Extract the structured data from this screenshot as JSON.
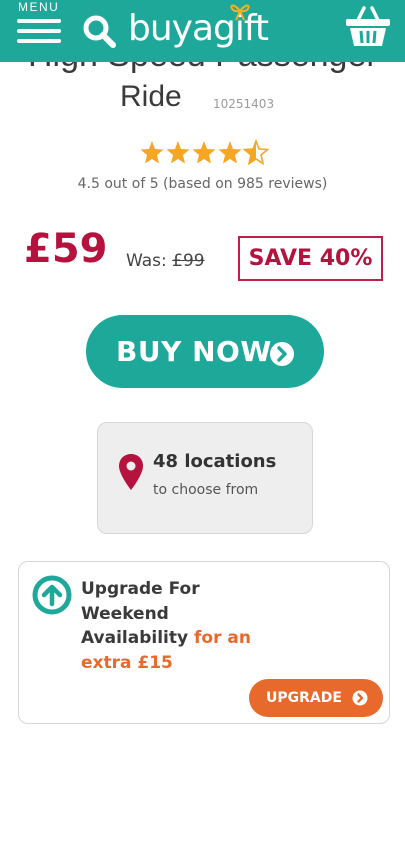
{
  "header": {
    "menu_label": "MENU",
    "logo_text": "buyagift",
    "icons": {
      "menu": "hamburger-icon",
      "search": "search-icon",
      "basket": "basket-icon"
    },
    "brand_color": "#1ea89a"
  },
  "product": {
    "title_line1": "High Speed Passenger",
    "title_line2": "Ride",
    "code": "10251403",
    "rating": 4.5,
    "rating_text": "4.5 out of 5 (based on 985 reviews)"
  },
  "pricing": {
    "price": "£59",
    "was_label": "Was:",
    "was_price": "£99",
    "save_label": "SAVE 40%",
    "price_color": "#b5123e"
  },
  "actions": {
    "buy_now_label": "BUY NOW"
  },
  "locations": {
    "count_label": "48 locations",
    "sub_label": "to choose from"
  },
  "upgrade": {
    "text_main": "Upgrade For Weekend Availability",
    "text_accent": "for an extra £15",
    "button_label": "UPGRADE",
    "accent_color": "#e8692c"
  }
}
